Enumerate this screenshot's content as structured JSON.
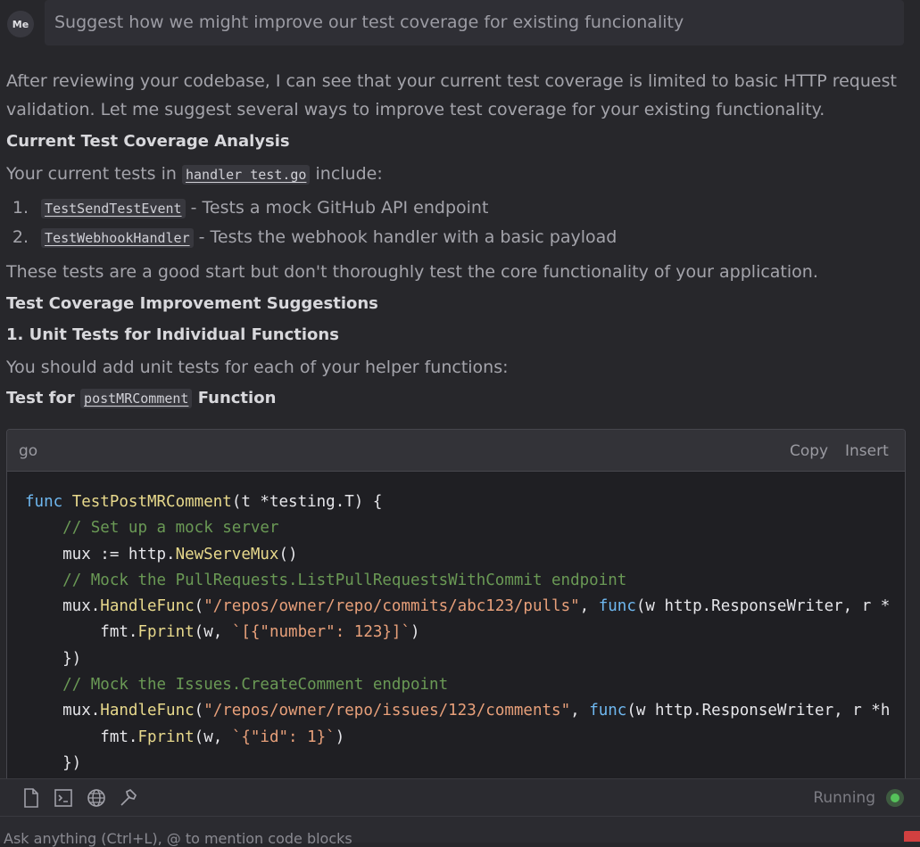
{
  "user": {
    "avatar": "Me",
    "message": "Suggest how we might improve our test coverage for existing funcionality"
  },
  "response": {
    "intro_1": "After reviewing your codebase, I can see that your current test coverage is limited to basic HTTP request",
    "intro_2": "validation. Let me suggest several ways to improve test coverage for your existing functionality.",
    "h_analysis": "Current Test Coverage Analysis",
    "current_pre": "Your current tests in",
    "current_file": "handler_test.go",
    "current_post": "include:",
    "list": [
      {
        "num": "1.",
        "code": "TestSendTestEvent",
        "text": "- Tests a mock GitHub API endpoint"
      },
      {
        "num": "2.",
        "code": "TestWebhookHandler",
        "text": "- Tests the webhook handler with a basic payload"
      }
    ],
    "good_start": "These tests are a good start but don't thoroughly test the core functionality of your application.",
    "h_suggestions": "Test Coverage Improvement Suggestions",
    "h_unit": "1. Unit Tests for Individual Functions",
    "unit_text": "You should add unit tests for each of your helper functions:",
    "test_for_pre": "Test for",
    "test_for_code": "postMRComment",
    "test_for_post": "Function"
  },
  "code_block": {
    "lang": "go",
    "copy_label": "Copy",
    "insert_label": "Insert",
    "lines": [
      [
        [
          "kw",
          "func"
        ],
        [
          "tx",
          " "
        ],
        [
          "fn",
          "TestPostMRComment"
        ],
        [
          "tx",
          "(t *testing.T) {"
        ]
      ],
      [
        [
          "tx",
          "    "
        ],
        [
          "cm",
          "// Set up a mock server"
        ]
      ],
      [
        [
          "tx",
          "    mux := http."
        ],
        [
          "fn",
          "NewServeMux"
        ],
        [
          "tx",
          "()"
        ]
      ],
      [
        [
          "tx",
          "    "
        ],
        [
          "cm",
          "// Mock the PullRequests.ListPullRequestsWithCommit endpoint"
        ]
      ],
      [
        [
          "tx",
          "    mux."
        ],
        [
          "fn",
          "HandleFunc"
        ],
        [
          "tx",
          "("
        ],
        [
          "str",
          "\"/repos/owner/repo/commits/abc123/pulls\""
        ],
        [
          "tx",
          ", "
        ],
        [
          "kw",
          "func"
        ],
        [
          "tx",
          "(w http.ResponseWriter, r *"
        ]
      ],
      [
        [
          "tx",
          "        fmt."
        ],
        [
          "fn",
          "Fprint"
        ],
        [
          "tx",
          "(w, "
        ],
        [
          "str",
          "`[{\"number\": 123}]`"
        ],
        [
          "tx",
          ")"
        ]
      ],
      [
        [
          "tx",
          "    })"
        ]
      ],
      [
        [
          "tx",
          "    "
        ],
        [
          "cm",
          "// Mock the Issues.CreateComment endpoint"
        ]
      ],
      [
        [
          "tx",
          "    mux."
        ],
        [
          "fn",
          "HandleFunc"
        ],
        [
          "tx",
          "("
        ],
        [
          "str",
          "\"/repos/owner/repo/issues/123/comments\""
        ],
        [
          "tx",
          ", "
        ],
        [
          "kw",
          "func"
        ],
        [
          "tx",
          "(w http.ResponseWriter, r *h"
        ]
      ],
      [
        [
          "tx",
          "        fmt."
        ],
        [
          "fn",
          "Fprint"
        ],
        [
          "tx",
          "(w, "
        ],
        [
          "str",
          "`{\"id\": 1}`"
        ],
        [
          "tx",
          ")"
        ]
      ],
      [
        [
          "tx",
          "    })"
        ]
      ]
    ]
  },
  "toolbar": {
    "icons": [
      "file-icon",
      "terminal-icon",
      "globe-icon",
      "hammer-icon"
    ],
    "status": "Running",
    "status_color": "#55c25a"
  },
  "input": {
    "placeholder": "Ask anything (Ctrl+L), @ to mention code blocks"
  }
}
